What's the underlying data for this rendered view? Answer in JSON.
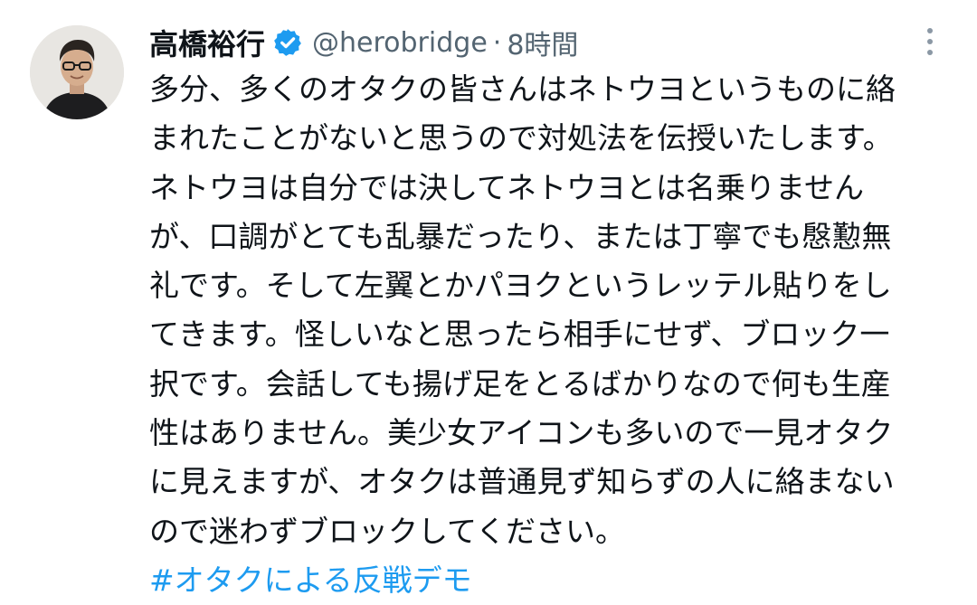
{
  "tweet": {
    "display_name": "高橋裕行",
    "handle": "@herobridge",
    "separator": "·",
    "time": "8時間",
    "text_lines": [
      "多分、多くのオタクの皆さんはネトウヨというものに絡",
      "まれたことがないと思うので対処法を伝授いたします。",
      "ネトウヨは自分では決してネトウヨとは名乗りません",
      "が、口調がとても乱暴だったり、または丁寧でも慇懃無",
      "礼です。そして左翼とかパヨクというレッテル貼りをし",
      "てきます。怪しいなと思ったら相手にせず、ブロック一",
      "択です。会話しても揚げ足をとるばかりなので何も生産",
      "性はありません。美少女アイコンも多いので一見オタク",
      "に見えますが、オタクは普通見ず知らずの人に絡まない",
      "ので迷わずブロックしてください。"
    ],
    "hashtag": "#オタクによる反戦デモ"
  },
  "colors": {
    "text": "#0f1419",
    "secondary": "#536471",
    "accent": "#1d9bf0",
    "background": "#ffffff"
  },
  "icons": {
    "avatar": "profile-photo",
    "verified": "verified-badge-icon",
    "more": "more-options-icon"
  }
}
